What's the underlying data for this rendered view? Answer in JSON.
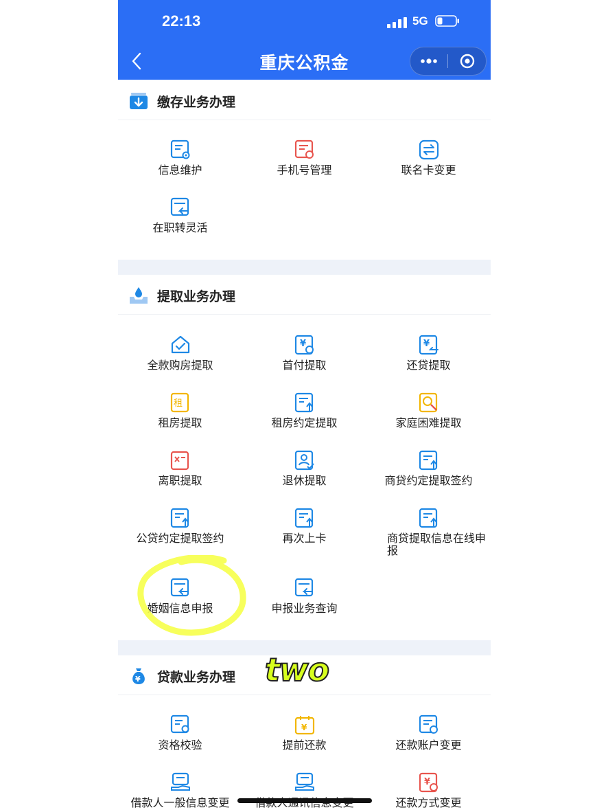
{
  "status_bar": {
    "time": "22:13",
    "network": "5G"
  },
  "nav": {
    "title": "重庆公积金"
  },
  "sections": {
    "deposit": {
      "title": "缴存业务办理",
      "items": [
        "信息维护",
        "手机号管理",
        "联名卡变更",
        "在职转灵活"
      ]
    },
    "withdraw": {
      "title": "提取业务办理",
      "items": [
        "全款购房提取",
        "首付提取",
        "还贷提取",
        "租房提取",
        "租房约定提取",
        "家庭困难提取",
        "离职提取",
        "退休提取",
        "商贷约定提取签约",
        "公贷约定提取签约",
        "再次上卡",
        "商贷提取信息在线申报",
        "婚姻信息申报",
        "申报业务查询"
      ]
    },
    "loan": {
      "title": "贷款业务办理",
      "items": [
        "资格校验",
        "提前还款",
        "还款账户变更",
        "借款人一般信息变更",
        "借款人通讯信息变更",
        "还款方式变更"
      ]
    }
  },
  "annotation": {
    "sticker_text": "two"
  },
  "colors": {
    "header": "#2b6ef5",
    "icon_blue": "#1e88e5",
    "icon_red": "#e8554e",
    "icon_yellow": "#f2b600",
    "highlight": "#f6ff4a"
  }
}
